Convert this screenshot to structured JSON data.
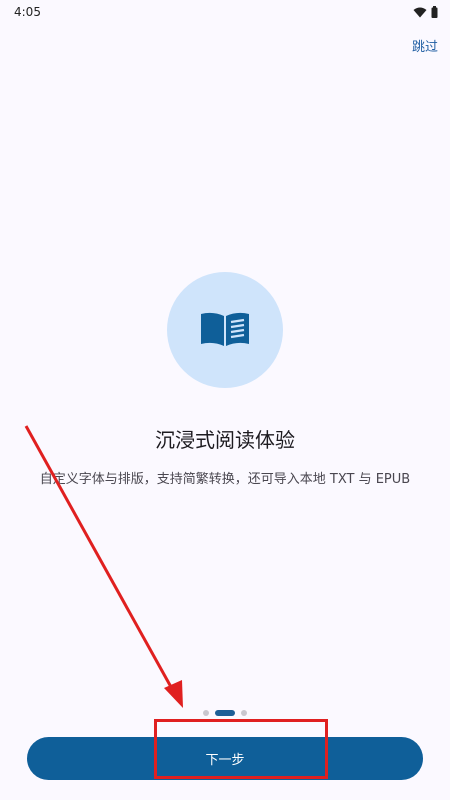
{
  "status_bar": {
    "time": "4:05",
    "icons": [
      "wifi-icon",
      "battery-icon"
    ]
  },
  "header": {
    "skip_label": "跳过"
  },
  "onboarding": {
    "icon": "book-icon",
    "title": "沉浸式阅读体验",
    "subtitle": "自定义字体与排版，支持简繁转换，还可导入本地 TXT 与 EPUB",
    "page_indicator": {
      "total": 3,
      "active": 2
    }
  },
  "footer": {
    "next_label": "下一步"
  },
  "colors": {
    "background": "#fbf9ff",
    "accent": "#0f5f99",
    "hero_circle": "#cfe4fb",
    "annotation": "#e02020"
  }
}
